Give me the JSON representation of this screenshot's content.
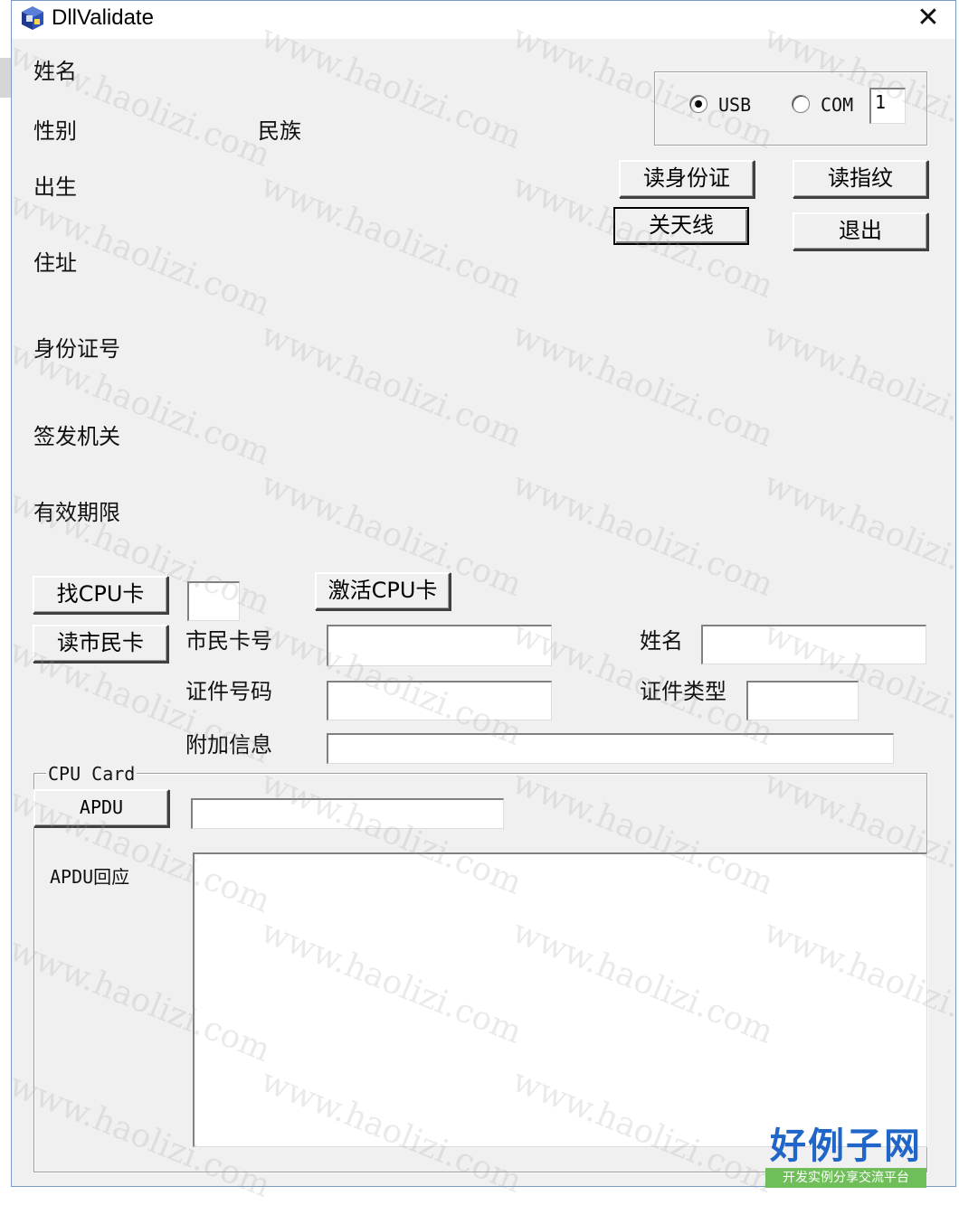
{
  "window": {
    "title": "DllValidate",
    "close_glyph": "✕"
  },
  "info_labels": {
    "name": "姓名",
    "gender": "性别",
    "ethnicity": "民族",
    "birth": "出生",
    "address": "住址",
    "id_number": "身份证号",
    "issuing_authority": "签发机关",
    "validity": "有效期限"
  },
  "port": {
    "usb_label": "USB",
    "com_label": "COM",
    "selected": "USB",
    "com_number": "1"
  },
  "buttons": {
    "read_id": "读身份证",
    "read_fingerprint": "读指纹",
    "close_antenna": "关天线",
    "exit": "退出",
    "find_cpu_card": "找CPU卡",
    "activate_cpu_card": "激活CPU卡",
    "read_citizen_card": "读市民卡",
    "apdu": "APDU"
  },
  "citizen_card": {
    "card_number_label": "市民卡号",
    "name_label": "姓名",
    "cert_number_label": "证件号码",
    "cert_type_label": "证件类型",
    "extra_info_label": "附加信息",
    "card_number_value": "",
    "name_value": "",
    "cert_number_value": "",
    "cert_type_value": "",
    "extra_info_value": "",
    "cpu_find_value": ""
  },
  "cpu_card": {
    "group_label": "CPU Card",
    "apdu_response_label": "APDU回应",
    "apdu_value": "",
    "apdu_response_value": ""
  },
  "watermark": {
    "text": "www.haolizi.com"
  },
  "badge": {
    "main": "好例子网",
    "sub": "开发实例分享交流平台"
  },
  "colors": {
    "window_bg": "#f0f0f0",
    "badge_blue": "#1f66c8",
    "badge_green": "#6fbe5a"
  }
}
